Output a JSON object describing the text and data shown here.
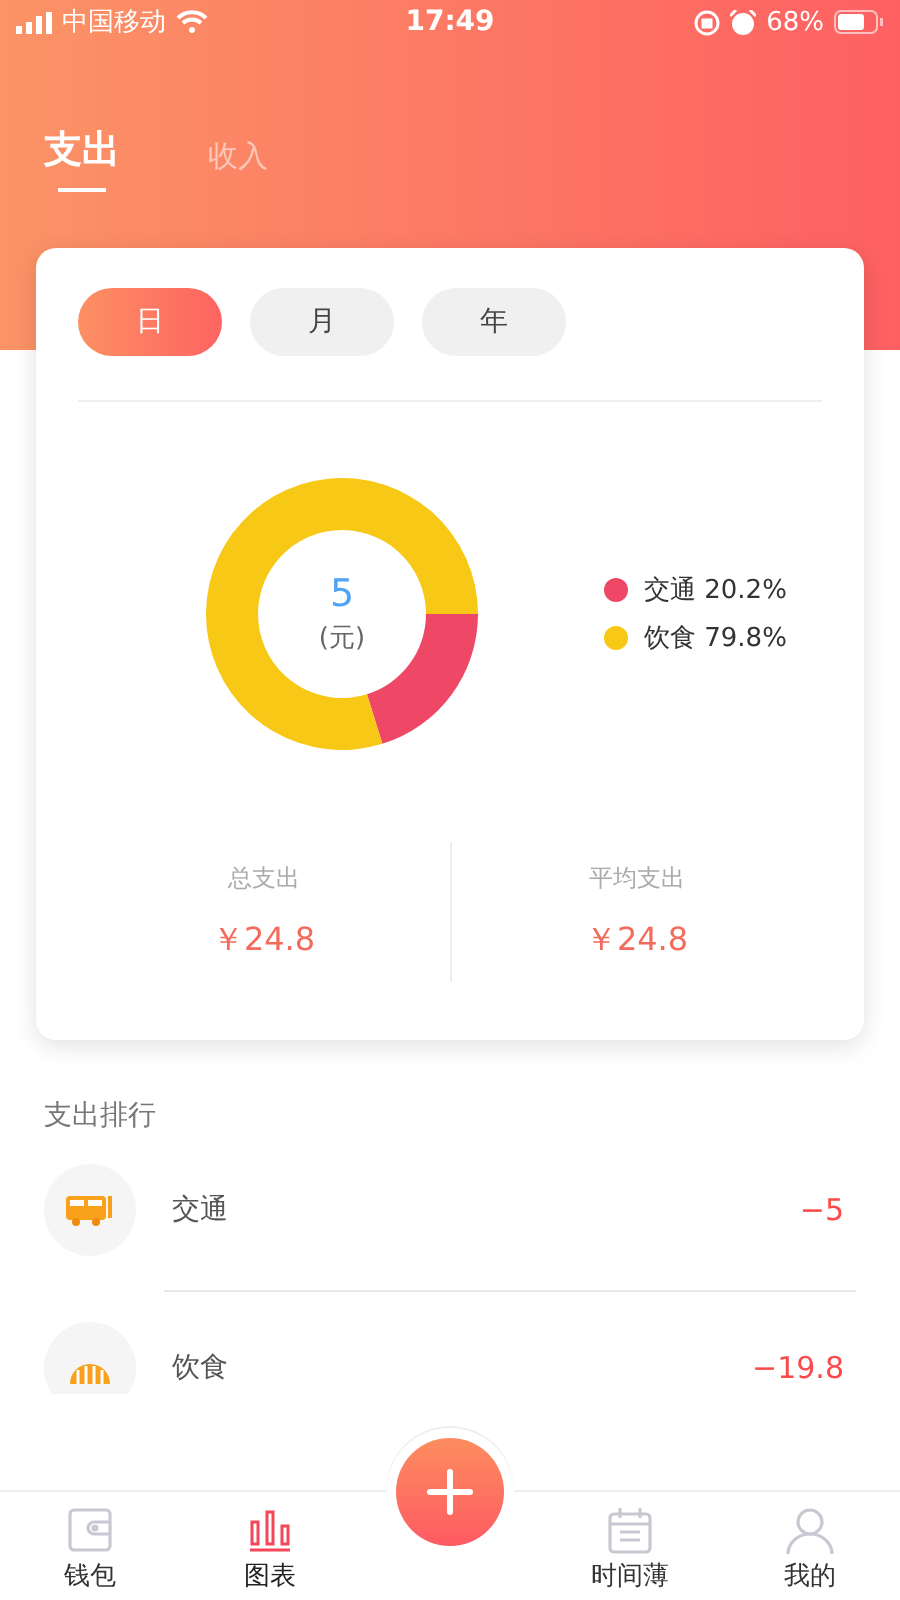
{
  "status_bar": {
    "carrier": "中国移动",
    "time": "17:49",
    "battery": "68%"
  },
  "tabs": [
    {
      "label": "支出",
      "selected": true
    },
    {
      "label": "收入",
      "selected": false
    }
  ],
  "periods": [
    {
      "label": "日",
      "selected": true
    },
    {
      "label": "月",
      "selected": false
    },
    {
      "label": "年",
      "selected": false
    }
  ],
  "chart": {
    "center_value": "5",
    "center_unit": "(元)",
    "chart_data": {
      "type": "donut",
      "categories": [
        "交通",
        "饮食"
      ],
      "values": [
        20.2,
        79.8
      ]
    },
    "legend": [
      {
        "percent": "20.2%",
        "color": "#ee4866"
      },
      {
        "percent": "79.8%",
        "color": "#f8c817"
      }
    ]
  },
  "stats": [
    {
      "label": "总支出",
      "value": "￥24.8"
    },
    {
      "label": "平均支出",
      "value": "￥24.8"
    }
  ],
  "ranking": {
    "title": "支出排行",
    "items": [
      {
        "kind": "bus",
        "name": "交通",
        "amount": "−5"
      },
      {
        "kind": "food",
        "name": "饮食",
        "amount": "−19.8"
      }
    ]
  },
  "nav": [
    {
      "label": "钱包",
      "kind": "wallet",
      "selected": false
    },
    {
      "label": "图表",
      "kind": "chart",
      "selected": true
    },
    {
      "kind": "add"
    },
    {
      "label": "时间薄",
      "kind": "calendar",
      "selected": false
    },
    {
      "label": "我的",
      "kind": "user",
      "selected": false
    }
  ]
}
